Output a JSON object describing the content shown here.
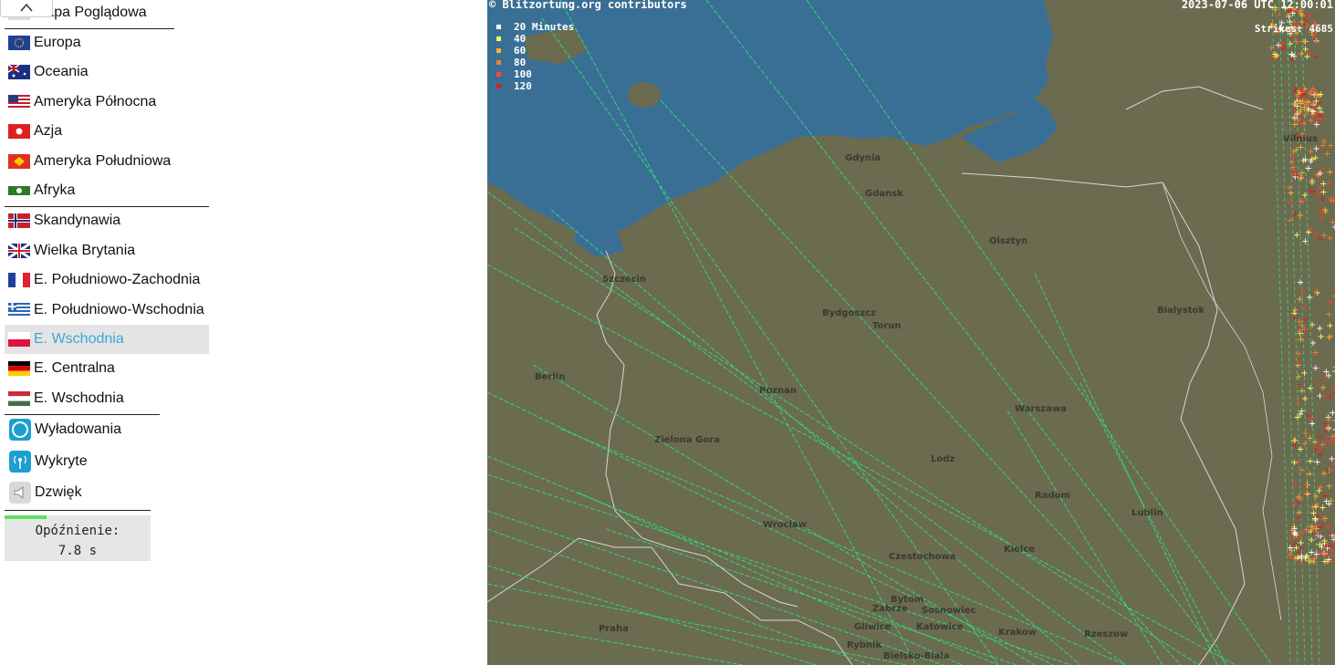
{
  "sidebar": {
    "menu": [
      {
        "label": "Mapa Poglądowa",
        "flag": "world"
      },
      {
        "label": "Europa",
        "flag": "eu"
      },
      {
        "label": "Oceania",
        "flag": "au"
      },
      {
        "label": "Ameryka Północna",
        "flag": "us"
      },
      {
        "label": "Azja",
        "flag": "hk"
      },
      {
        "label": "Ameryka Południowa",
        "flag": "br-like"
      },
      {
        "label": "Afryka",
        "flag": "africa"
      },
      {
        "label": "Skandynawia",
        "flag": "no"
      },
      {
        "label": "Wielka Brytania",
        "flag": "gb"
      },
      {
        "label": "E. Południowo-Zachodnia",
        "flag": "fr"
      },
      {
        "label": "E. Południowo-Wschodnia",
        "flag": "gr"
      },
      {
        "label": "E. Wschodnia",
        "flag": "pl",
        "active": true
      },
      {
        "label": "E. Centralna",
        "flag": "de"
      },
      {
        "label": "E. Wschodnia",
        "flag": "hu"
      }
    ],
    "tools": [
      {
        "label": "Wyładowania",
        "icon": "circle-icon"
      },
      {
        "label": "Wykryte",
        "icon": "antenna-icon"
      },
      {
        "label": "Dzwięk",
        "icon": "speaker-icon"
      }
    ],
    "delay": {
      "title": "Opóźnienie:",
      "value": "7.8 s"
    }
  },
  "map": {
    "attribution": "© Blitzortung.org contributors",
    "timestamp": "2023-07-06 UTC 12:00:01",
    "strikes": "Strikes: 4685",
    "legend": [
      {
        "label": "20 Minutes",
        "color": "#ffffff"
      },
      {
        "label": "40",
        "color": "#ffff66"
      },
      {
        "label": "60",
        "color": "#ffb030"
      },
      {
        "label": "80",
        "color": "#ff7a30"
      },
      {
        "label": "100",
        "color": "#ff4a3a"
      },
      {
        "label": "120",
        "color": "#d82020"
      }
    ],
    "cities": [
      "Gdynia",
      "Gdansk",
      "Olsztyn",
      "Szczecin",
      "Bydgoszcz",
      "Torun",
      "Bialystok",
      "Berlin",
      "Poznan",
      "Warszawa",
      "Zielona Gora",
      "Lodz",
      "Radom",
      "Lublin",
      "Wroclaw",
      "Kielce",
      "Czestochowa",
      "Praha",
      "Bytom",
      "Gliwice",
      "Katowice",
      "Krakow",
      "Rzeszow",
      "Zabrze",
      "Sosnowiec",
      "Rybnik",
      "Bielsko-Biala",
      "Vilnius"
    ],
    "colors": {
      "sea": "#3a6f95",
      "land": "#6b6b50",
      "border": "#d8d8d8",
      "strike_line": "#2fe078"
    }
  }
}
